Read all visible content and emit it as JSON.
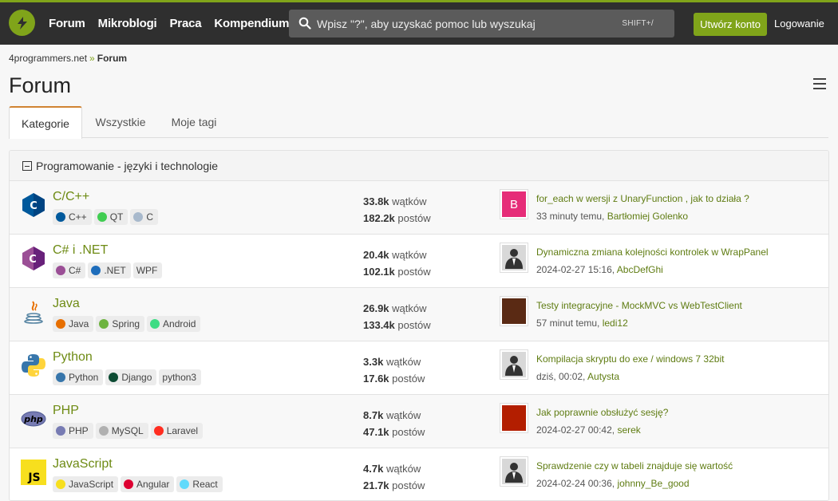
{
  "nav": {
    "items": [
      "Forum",
      "Mikroblogi",
      "Praca",
      "Kompendium"
    ]
  },
  "search": {
    "placeholder": "Wpisz \"?\", aby uzyskać pomoc lub wyszukaj",
    "shortcut": "SHIFT+/"
  },
  "header": {
    "create_account": "Utwórz konto",
    "login": "Logowanie"
  },
  "breadcrumb": {
    "home": "4programmers.net",
    "sep": "»",
    "current": "Forum"
  },
  "page": {
    "title": "Forum"
  },
  "tabs": [
    {
      "label": "Kategorie"
    },
    {
      "label": "Wszystkie"
    },
    {
      "label": "Moje tagi"
    }
  ],
  "section": {
    "title": "Programowanie - języki i technologie"
  },
  "categories": [
    {
      "name": "C/C++",
      "icon": "cpp-icon",
      "tags": [
        {
          "label": "C++",
          "icon": "cpp-tag-icon"
        },
        {
          "label": "QT",
          "icon": "qt-tag-icon"
        },
        {
          "label": "C",
          "icon": "c-tag-icon"
        }
      ],
      "threads": "33.8k",
      "threads_label": "wątków",
      "posts": "182.2k",
      "posts_label": "postów",
      "last_topic": "for_each w wersji z UnaryFunction , jak to działa ?",
      "last_time": "33 minuty temu,",
      "last_user": "Bartłomiej Golenko",
      "avatar": "B"
    },
    {
      "name": "C# i .NET",
      "icon": "csharp-icon",
      "tags": [
        {
          "label": "C#",
          "icon": "csharp-tag-icon"
        },
        {
          "label": ".NET",
          "icon": "dotnet-tag-icon"
        },
        {
          "label": "WPF",
          "icon": ""
        }
      ],
      "threads": "20.4k",
      "threads_label": "wątków",
      "posts": "102.1k",
      "posts_label": "postów",
      "last_topic": "Dynamiczna zmiana kolejności kontrolek w WrapPanel",
      "last_time": "2024-02-27 15:16,",
      "last_user": "AbcDefGhi",
      "avatar": ""
    },
    {
      "name": "Java",
      "icon": "java-icon",
      "tags": [
        {
          "label": "Java",
          "icon": "java-tag-icon"
        },
        {
          "label": "Spring",
          "icon": "spring-tag-icon"
        },
        {
          "label": "Android",
          "icon": "android-tag-icon"
        }
      ],
      "threads": "26.9k",
      "threads_label": "wątków",
      "posts": "133.4k",
      "posts_label": "postów",
      "last_topic": "Testy integracyjne - MockMVC vs WebTestClient",
      "last_time": "57 minut temu,",
      "last_user": "ledi12",
      "avatar": ""
    },
    {
      "name": "Python",
      "icon": "python-icon",
      "tags": [
        {
          "label": "Python",
          "icon": "python-tag-icon"
        },
        {
          "label": "Django",
          "icon": "django-tag-icon"
        },
        {
          "label": "python3",
          "icon": ""
        }
      ],
      "threads": "3.3k",
      "threads_label": "wątków",
      "posts": "17.6k",
      "posts_label": "postów",
      "last_topic": "Kompilacja skryptu do exe / windows 7 32bit",
      "last_time": "dziś, 00:02,",
      "last_user": "Autysta",
      "avatar": ""
    },
    {
      "name": "PHP",
      "icon": "php-icon",
      "tags": [
        {
          "label": "PHP",
          "icon": "php-tag-icon"
        },
        {
          "label": "MySQL",
          "icon": "mysql-tag-icon"
        },
        {
          "label": "Laravel",
          "icon": "laravel-tag-icon"
        }
      ],
      "threads": "8.7k",
      "threads_label": "wątków",
      "posts": "47.1k",
      "posts_label": "postów",
      "last_topic": "Jak poprawnie obsłużyć sesję?",
      "last_time": "2024-02-27 00:42,",
      "last_user": "serek",
      "avatar": ""
    },
    {
      "name": "JavaScript",
      "icon": "javascript-icon",
      "tags": [
        {
          "label": "JavaScript",
          "icon": "js-tag-icon"
        },
        {
          "label": "Angular",
          "icon": "angular-tag-icon"
        },
        {
          "label": "React",
          "icon": "react-tag-icon"
        }
      ],
      "threads": "4.7k",
      "threads_label": "wątków",
      "posts": "21.7k",
      "posts_label": "postów",
      "last_topic": "Sprawdzenie czy w tabeli znajduje się wartość",
      "last_time": "2024-02-24 00:36,",
      "last_user": "johnny_Be_good",
      "avatar": ""
    }
  ],
  "colors": {
    "accent": "#80a41a",
    "link": "#6e8b14",
    "topbar": "#2f2f2f",
    "tab_active_border": "#d08332"
  }
}
